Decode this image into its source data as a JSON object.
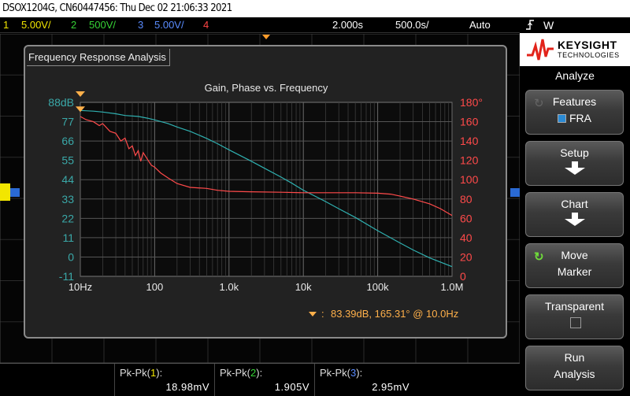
{
  "window_title": "DSOX1204G, CN60447456: Thu Dec 02 21:06:33 2021",
  "status": {
    "channels": [
      {
        "num": "1",
        "scale": "5.00V/",
        "color": "#f2e600"
      },
      {
        "num": "2",
        "scale": "500V/",
        "color": "#36d336"
      },
      {
        "num": "3",
        "scale": "5.00V/",
        "color": "#5a8cff"
      },
      {
        "num": "4",
        "scale": "",
        "color": "#ff4545"
      }
    ],
    "timebase": "2.000s",
    "time_div": "500.0s/",
    "trigger_mode": "Auto",
    "trigger_icon": "trigger-rise-icon",
    "trigger_source": "W"
  },
  "fra": {
    "window_label": "Frequency Response Analysis",
    "chart_title": "Gain, Phase vs. Frequency",
    "readout": "83.39dB, 165.31° @ 10.0Hz"
  },
  "chart_data": {
    "type": "line",
    "title": "Gain, Phase vs. Frequency",
    "x_scale": "log",
    "xlim": [
      10,
      1000000
    ],
    "x_ticks": [
      "10Hz",
      "100",
      "1.0k",
      "10k",
      "100k",
      "1.0M"
    ],
    "y_left": {
      "unit": "dB",
      "ylim": [
        -11,
        88
      ],
      "ticks": [
        "88dB",
        "77",
        "66",
        "55",
        "44",
        "33",
        "22",
        "11",
        "0",
        "-11"
      ],
      "color": "#3aa8a8"
    },
    "y_right": {
      "unit": "deg",
      "ylim": [
        0,
        180
      ],
      "ticks": [
        "180°",
        "160",
        "140",
        "120",
        "100",
        "80",
        "60",
        "40",
        "20",
        "0"
      ],
      "color": "#ff4a4a"
    },
    "grid": true,
    "series": [
      {
        "axis": "left",
        "color": "#2fb0b0",
        "x": [
          10,
          15,
          20,
          30,
          40,
          60,
          80,
          100,
          150,
          200,
          300,
          500,
          700,
          1000,
          2000,
          3000,
          5000,
          7000,
          10000,
          20000,
          30000,
          50000,
          100000,
          200000,
          300000,
          500000,
          1000000
        ],
        "y": [
          83.4,
          83.0,
          82.5,
          81.5,
          80.5,
          80.0,
          79.0,
          78.0,
          76.0,
          74.0,
          71.5,
          67.5,
          64.5,
          61.0,
          54.5,
          50.5,
          45.5,
          42.0,
          38.0,
          31.5,
          27.5,
          22.5,
          15.0,
          8.0,
          4.0,
          -0.5,
          -5.5
        ]
      },
      {
        "axis": "right",
        "color": "#ff4a4a",
        "x": [
          10,
          12,
          15,
          18,
          20,
          25,
          30,
          35,
          40,
          45,
          50,
          55,
          60,
          65,
          70,
          80,
          90,
          100,
          120,
          150,
          200,
          300,
          500,
          700,
          1000,
          2000,
          5000,
          10000,
          20000,
          50000,
          100000,
          150000,
          200000,
          300000,
          500000,
          700000,
          1000000
        ],
        "y": [
          165.3,
          162,
          160,
          156,
          158,
          150,
          148,
          140,
          143,
          132,
          135,
          125,
          130,
          119,
          128,
          121,
          115,
          113,
          107,
          102,
          96,
          92,
          91,
          89,
          88,
          87.5,
          87,
          86.5,
          86.5,
          86.5,
          86,
          85,
          83,
          80,
          75,
          70,
          63
        ]
      }
    ],
    "cursor": {
      "x": 10,
      "gain_db": 83.39,
      "phase_deg": 165.31
    }
  },
  "measurements": [
    {
      "label": "Pk-Pk(",
      "ch": "1",
      "close": "):",
      "value": "18.98mV",
      "color": "#f2e600"
    },
    {
      "label": "Pk-Pk(",
      "ch": "2",
      "close": "):",
      "value": "1.905V",
      "color": "#36d336"
    },
    {
      "label": "Pk-Pk(",
      "ch": "3",
      "close": "):",
      "value": "2.95mV",
      "color": "#5a8cff"
    }
  ],
  "brand": {
    "name": "KEYSIGHT",
    "sub": "TECHNOLOGIES"
  },
  "menu": {
    "title": "Analyze",
    "softkeys": [
      {
        "line1": "Features",
        "line2": "FRA"
      },
      {
        "line1": "Setup"
      },
      {
        "line1": "Chart"
      },
      {
        "line1": "Move",
        "line2": "Marker"
      },
      {
        "line1": "Transparent"
      },
      {
        "line1": "Run",
        "line2": "Analysis"
      }
    ]
  }
}
